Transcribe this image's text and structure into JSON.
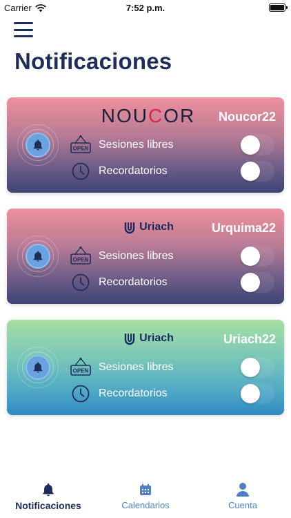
{
  "status_bar": {
    "carrier": "Carrier",
    "time": "7:52 p.m."
  },
  "header": {
    "title": "Notificaciones"
  },
  "cards": [
    {
      "logo_text_left": "NOU",
      "logo_text_accent": "C",
      "logo_text_right": "OR",
      "name": "Noucor22",
      "rows": [
        {
          "label": "Sesiones libres",
          "icon": "open-sign-icon",
          "toggle_on": false
        },
        {
          "label": "Recordatorios",
          "icon": "clock-icon",
          "toggle_on": false
        }
      ]
    },
    {
      "logo_text": "Uriach",
      "name": "Urquima22",
      "rows": [
        {
          "label": "Sesiones libres",
          "icon": "open-sign-icon",
          "toggle_on": false
        },
        {
          "label": "Recordatorios",
          "icon": "clock-icon",
          "toggle_on": false
        }
      ]
    },
    {
      "logo_text": "Uriach",
      "name": "Uriach22",
      "rows": [
        {
          "label": "Sesiones libres",
          "icon": "open-sign-icon",
          "toggle_on": false
        },
        {
          "label": "Recordatorios",
          "icon": "clock-icon",
          "toggle_on": false
        }
      ]
    }
  ],
  "open_sign_text": "OPEN",
  "tab_bar": {
    "tabs": [
      {
        "label": "Notificaciones",
        "icon": "bell-icon",
        "active": true
      },
      {
        "label": "Calendarios",
        "icon": "calendar-icon",
        "active": false
      },
      {
        "label": "Cuenta",
        "icon": "person-icon",
        "active": false
      }
    ]
  },
  "colors": {
    "primary": "#1f2d5a",
    "accent_blue": "#4f7fc4",
    "noucor_red": "#d6264d"
  }
}
